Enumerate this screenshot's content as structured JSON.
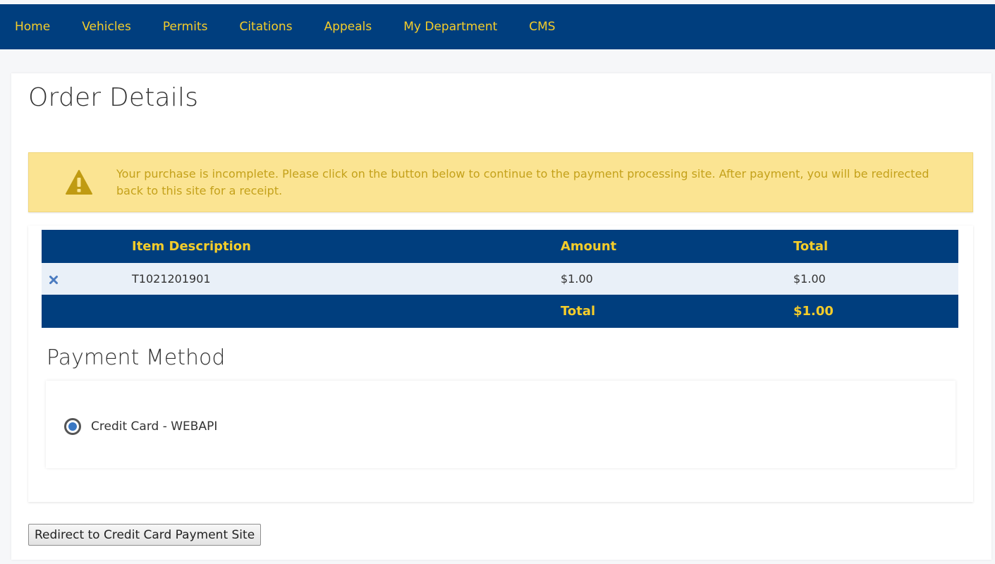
{
  "nav": {
    "items": [
      {
        "label": "Home"
      },
      {
        "label": "Vehicles"
      },
      {
        "label": "Permits"
      },
      {
        "label": "Citations"
      },
      {
        "label": "Appeals"
      },
      {
        "label": "My Department"
      },
      {
        "label": "CMS"
      }
    ]
  },
  "page": {
    "title": "Order Details"
  },
  "alert": {
    "icon": "warning-icon",
    "message": "Your purchase is incomplete. Please click on the button below to continue to the payment processing site. After payment, you will be redirected back to this site for a receipt."
  },
  "order_table": {
    "headers": {
      "description": "Item Description",
      "amount": "Amount",
      "total": "Total"
    },
    "rows": [
      {
        "description": "T1021201901",
        "amount": "$1.00",
        "total": "$1.00"
      }
    ],
    "footer": {
      "label": "Total",
      "value": "$1.00"
    }
  },
  "payment": {
    "heading": "Payment Method",
    "options": [
      {
        "label": "Credit Card - WEBAPI",
        "selected": true
      }
    ]
  },
  "actions": {
    "redirect_label": "Redirect to Credit Card Payment Site"
  },
  "colors": {
    "navbar": "#003e7e",
    "nav_text": "#f5cd2a",
    "alert_bg": "#fbe492",
    "alert_text": "#c4a11a",
    "row_bg": "#e9f0f8",
    "radio_accent": "#3a77c3"
  }
}
